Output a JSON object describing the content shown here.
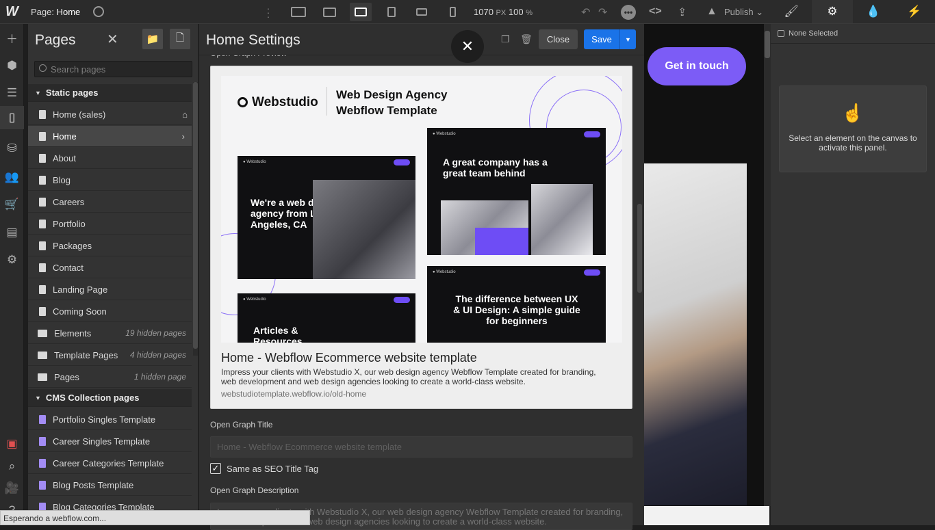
{
  "topbar": {
    "page_prefix": "Page:",
    "page_name": "Home",
    "width": "1070",
    "width_unit": "PX",
    "zoom": "100",
    "zoom_unit": "%",
    "publish_label": "Publish"
  },
  "right_panel": {
    "none_selected": "None Selected",
    "empty_message": "Select an element on the canvas to activate this panel."
  },
  "pages_panel": {
    "title": "Pages",
    "search_placeholder": "Search pages",
    "static_section": "Static pages",
    "static_pages": [
      {
        "label": "Home (sales)",
        "icon": "home-icon"
      },
      {
        "label": "Home",
        "icon": "chevron-right-icon",
        "selected": true
      },
      {
        "label": "About"
      },
      {
        "label": "Blog"
      },
      {
        "label": "Careers"
      },
      {
        "label": "Portfolio"
      },
      {
        "label": "Packages"
      },
      {
        "label": "Contact"
      },
      {
        "label": "Landing Page"
      },
      {
        "label": "Coming Soon"
      }
    ],
    "folders": [
      {
        "label": "Elements",
        "hidden": "19 hidden pages"
      },
      {
        "label": "Template Pages",
        "hidden": "4 hidden pages"
      },
      {
        "label": "Pages",
        "hidden": "1 hidden page"
      }
    ],
    "cms_section": "CMS Collection pages",
    "cms_pages": [
      {
        "label": "Portfolio Singles Template"
      },
      {
        "label": "Career Singles Template"
      },
      {
        "label": "Career Categories Template"
      },
      {
        "label": "Blog Posts Template"
      },
      {
        "label": "Blog Categories Template"
      }
    ]
  },
  "settings": {
    "title": "Home Settings",
    "close_label": "Close",
    "save_label": "Save",
    "og_preview_label": "Open Graph Preview",
    "og_card": {
      "title": "Home - Webflow Ecommerce website template",
      "description": "Impress your clients with Webstudio X, our web design agency Webflow Template created for branding, web development and web design agencies looking to create a world-class website.",
      "url": "webstudiotemplate.webflow.io/old-home",
      "image": {
        "brand": "Webstudio",
        "tagline_1": "Web Design Agency",
        "tagline_2": "Webflow Template",
        "hero_1": "We're a web design agency from Los Angeles, CA",
        "hero_2": "A great company has a great team behind",
        "hero_3": "The difference between UX & UI Design: A simple guide for beginners",
        "hero_4": "Articles & Resources"
      }
    },
    "og_title_label": "Open Graph Title",
    "og_title_value": "Home - Webflow Ecommerce website template",
    "same_as_seo_label": "Same as SEO Title Tag",
    "same_as_seo_checked": true,
    "og_desc_label": "Open Graph Description",
    "og_desc_value": "Impress your clients with Webstudio X, our web design agency Webflow Template created for branding, web development and web design agencies looking to create a world-class website."
  },
  "canvas": {
    "cta_label": "Get in touch"
  },
  "status_bar": {
    "text": "Esperando a webflow.com..."
  },
  "colors": {
    "accent_blue": "#1a73e8",
    "brand_purple": "#7c5cf6",
    "cms_icon": "#a38cf4"
  }
}
